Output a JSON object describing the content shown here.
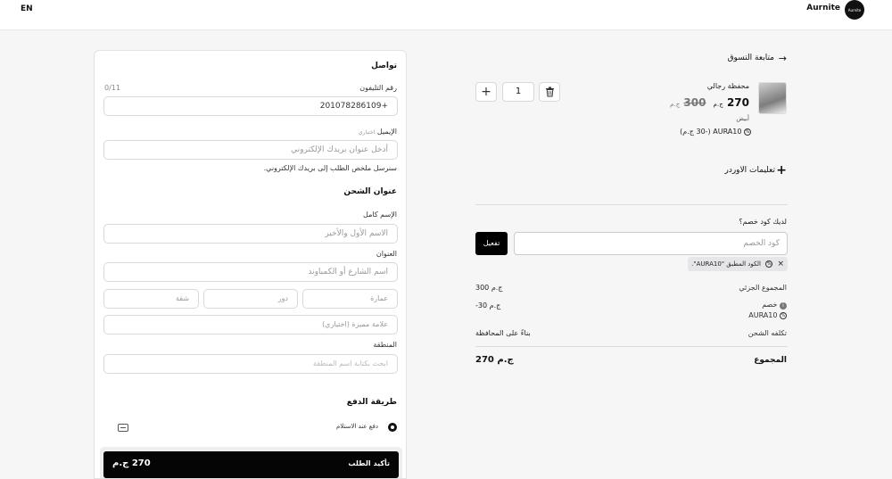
{
  "header": {
    "lang": "EN",
    "brand": "Aurnite",
    "logo_text": "Aurnite"
  },
  "form": {
    "contact_title": "تواصل",
    "phone_label": "رقم التليفون",
    "phone_counter": "0/11",
    "phone_value": "+201078286109",
    "email_label": "الإيميل",
    "email_optional": "اختياري",
    "email_placeholder": "أدخل عنوان بريدك الإلكتروني",
    "email_hint": "سنرسل ملخص الطلب إلى بريدك الإلكتروني.",
    "shipping_title": "عنوان الشحن",
    "name_label": "الإسم كامل",
    "name_placeholder": "الاسم الأول والأخير",
    "address_label": "العنوان",
    "address_placeholder": "اسم الشارع أو الكمباوند",
    "building_placeholder": "عمارة",
    "floor_placeholder": "دور",
    "apartment_placeholder": "شقة",
    "landmark_placeholder": "علامة مميزة (اختياري)",
    "region_label": "المنطقة",
    "region_placeholder": "ابحث بكتابة اسم المنطقة",
    "payment_title": "طريقة الدفع",
    "payment_option": "دفع عند الاستلام",
    "submit_label": "تأكيد الطلب",
    "submit_total": "270 ج.م"
  },
  "summary": {
    "back_label": "متابعة التسوق",
    "product_name": "محفظة رجالي",
    "price": "270",
    "price_currency": "ج.م",
    "old_price": "300",
    "old_currency": "ج.م",
    "color": "أبيض",
    "discount_tag": "AURA10 (-30 ج.م)",
    "quantity": "1",
    "notes_label": "تعليمات الاوردر",
    "discount_question": "لديك كود خصم؟",
    "code_placeholder": "كود الخصم",
    "apply_label": "تفعيل",
    "applied_chip": "الكود المطبق \"AURA10\".",
    "subtotal_label": "المجموع الجزئي",
    "subtotal_value": "300 ج.م",
    "discount_label": "خصم",
    "discount_code": "AURA10",
    "discount_value": "-30 ج.م",
    "shipping_label": "تكلفه الشحن",
    "shipping_value": "بناءً على المحافظة",
    "total_label": "المجموع",
    "total_value": "270 ج.م"
  }
}
